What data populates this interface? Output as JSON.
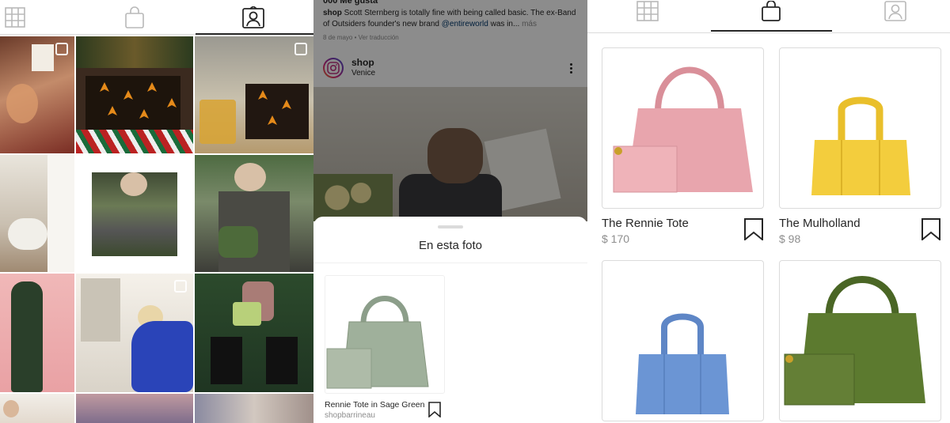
{
  "panel_a": {
    "tabs": [
      {
        "icon": "grid-icon"
      },
      {
        "icon": "shopping-bag-icon"
      },
      {
        "icon": "tagged-person-icon",
        "active": true
      }
    ]
  },
  "panel_b": {
    "likes": "000 Me gusta",
    "caption": {
      "username": "shop",
      "text_before": " Scott Sternberg is totally fine with being called basic. The ex-Band of Outsiders founder's new brand ",
      "mention": "@entireworld",
      "text_after": " was in...",
      "more": " más"
    },
    "date": "8 de mayo",
    "separator": " • ",
    "translate": "Ver traducción",
    "post_user": "shop",
    "post_location": "Venice",
    "sheet_title": "En esta foto",
    "product": {
      "name": "Rennie Tote in Sage Green",
      "shop": "shopbarrineau"
    }
  },
  "panel_c": {
    "products": [
      {
        "name": "The Rennie Tote",
        "price": "$ 170",
        "color": "#e8a5ad"
      },
      {
        "name": "The Mulholland",
        "price": "$ 98",
        "color": "#f3cd3d"
      },
      {
        "name": "",
        "price": "",
        "color": "#6b95d4"
      },
      {
        "name": "",
        "price": "",
        "color": "#5c7a2f"
      }
    ]
  },
  "colors": {
    "text_primary": "#262626",
    "text_secondary": "#8e8e8e",
    "divider": "#dbdbdb",
    "link": "#00376b"
  }
}
